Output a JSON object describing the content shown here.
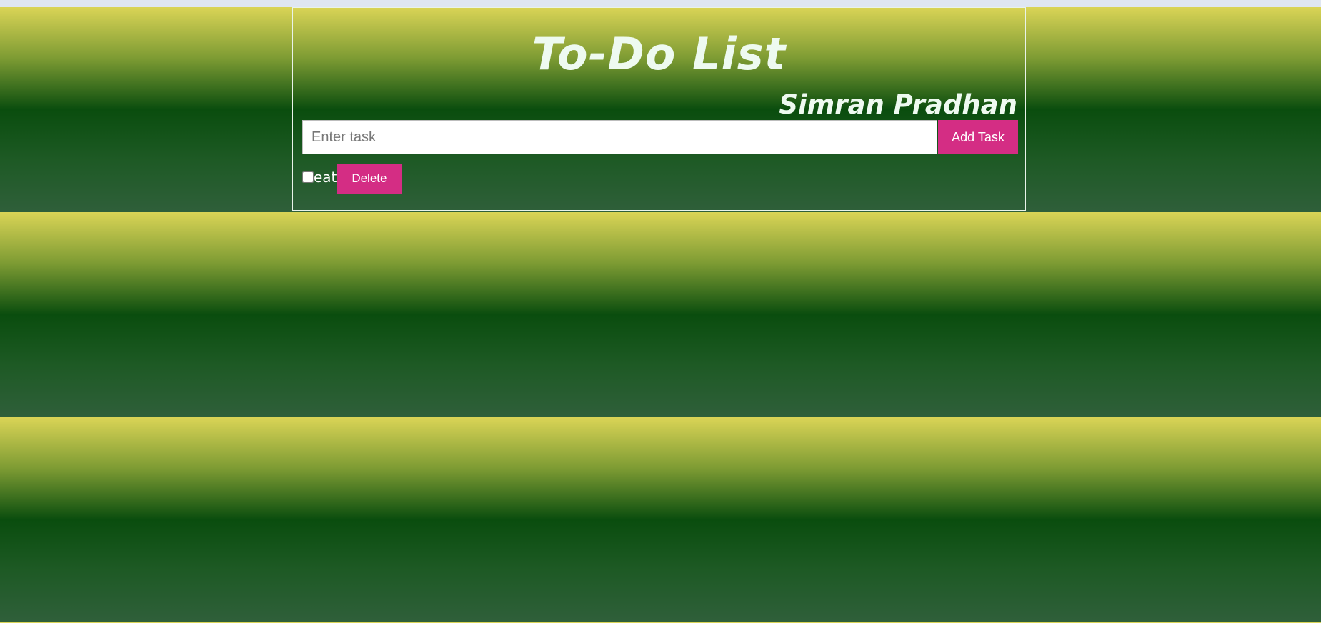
{
  "app": {
    "title": "To-Do List",
    "author": "Simran Pradhan"
  },
  "form": {
    "input_value": "",
    "input_placeholder": "Enter task",
    "add_button_label": "Add Task"
  },
  "tasks": [
    {
      "text": "eat",
      "checked": false,
      "delete_label": "Delete"
    }
  ],
  "colors": {
    "button_accent": "#d42d84",
    "gradient_top": "#dad456",
    "gradient_middle": "#0a4d0e",
    "gradient_bottom": "#2f5f3a",
    "heading_text": "#eefaf0"
  }
}
